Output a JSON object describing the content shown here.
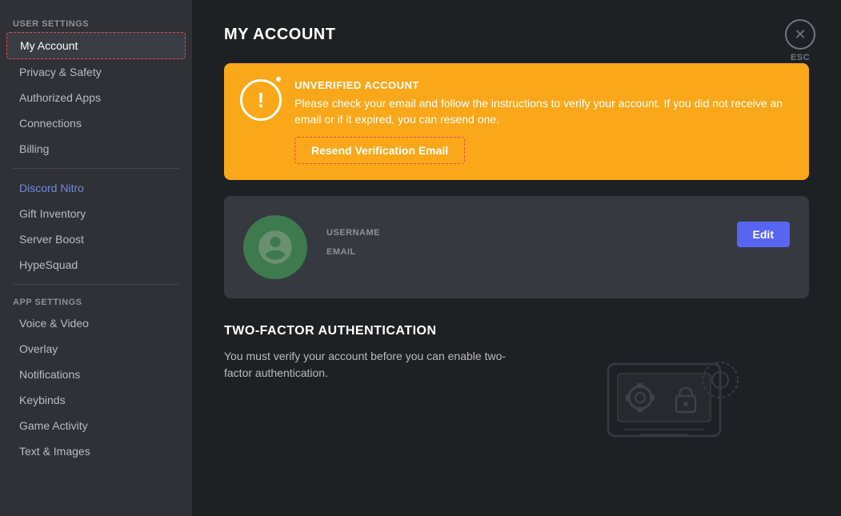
{
  "sidebar": {
    "user_settings_label": "USER SETTINGS",
    "app_settings_label": "APP SETTINGS",
    "items_user": [
      {
        "id": "my-account",
        "label": "My Account",
        "active": true,
        "accent": false
      },
      {
        "id": "privacy-safety",
        "label": "Privacy & Safety",
        "active": false,
        "accent": false
      },
      {
        "id": "authorized-apps",
        "label": "Authorized Apps",
        "active": false,
        "accent": false
      },
      {
        "id": "connections",
        "label": "Connections",
        "active": false,
        "accent": false
      },
      {
        "id": "billing",
        "label": "Billing",
        "active": false,
        "accent": false
      }
    ],
    "items_nitro": [
      {
        "id": "discord-nitro",
        "label": "Discord Nitro",
        "active": false,
        "accent": true
      },
      {
        "id": "gift-inventory",
        "label": "Gift Inventory",
        "active": false,
        "accent": false
      },
      {
        "id": "server-boost",
        "label": "Server Boost",
        "active": false,
        "accent": false
      },
      {
        "id": "hypesquad",
        "label": "HypeSquad",
        "active": false,
        "accent": false
      }
    ],
    "items_app": [
      {
        "id": "voice-video",
        "label": "Voice & Video",
        "active": false,
        "accent": false
      },
      {
        "id": "overlay",
        "label": "Overlay",
        "active": false,
        "accent": false
      },
      {
        "id": "notifications",
        "label": "Notifications",
        "active": false,
        "accent": false
      },
      {
        "id": "keybinds",
        "label": "Keybinds",
        "active": false,
        "accent": false
      },
      {
        "id": "game-activity",
        "label": "Game Activity",
        "active": false,
        "accent": false
      },
      {
        "id": "text-images",
        "label": "Text & Images",
        "active": false,
        "accent": false
      }
    ]
  },
  "main": {
    "page_title": "MY ACCOUNT",
    "banner": {
      "title": "UNVERIFIED ACCOUNT",
      "description": "Please check your email and follow the instructions to verify your account. If you did not receive an email or if it expired, you can resend one.",
      "button_label": "Resend Verification Email"
    },
    "account": {
      "username_label": "USERNAME",
      "username_value": "",
      "email_label": "EMAIL",
      "email_value": "",
      "edit_button": "Edit"
    },
    "two_factor": {
      "title": "TWO-FACTOR AUTHENTICATION",
      "description": "You must verify your account before you can enable two-factor authentication."
    },
    "esc_label": "ESC"
  }
}
